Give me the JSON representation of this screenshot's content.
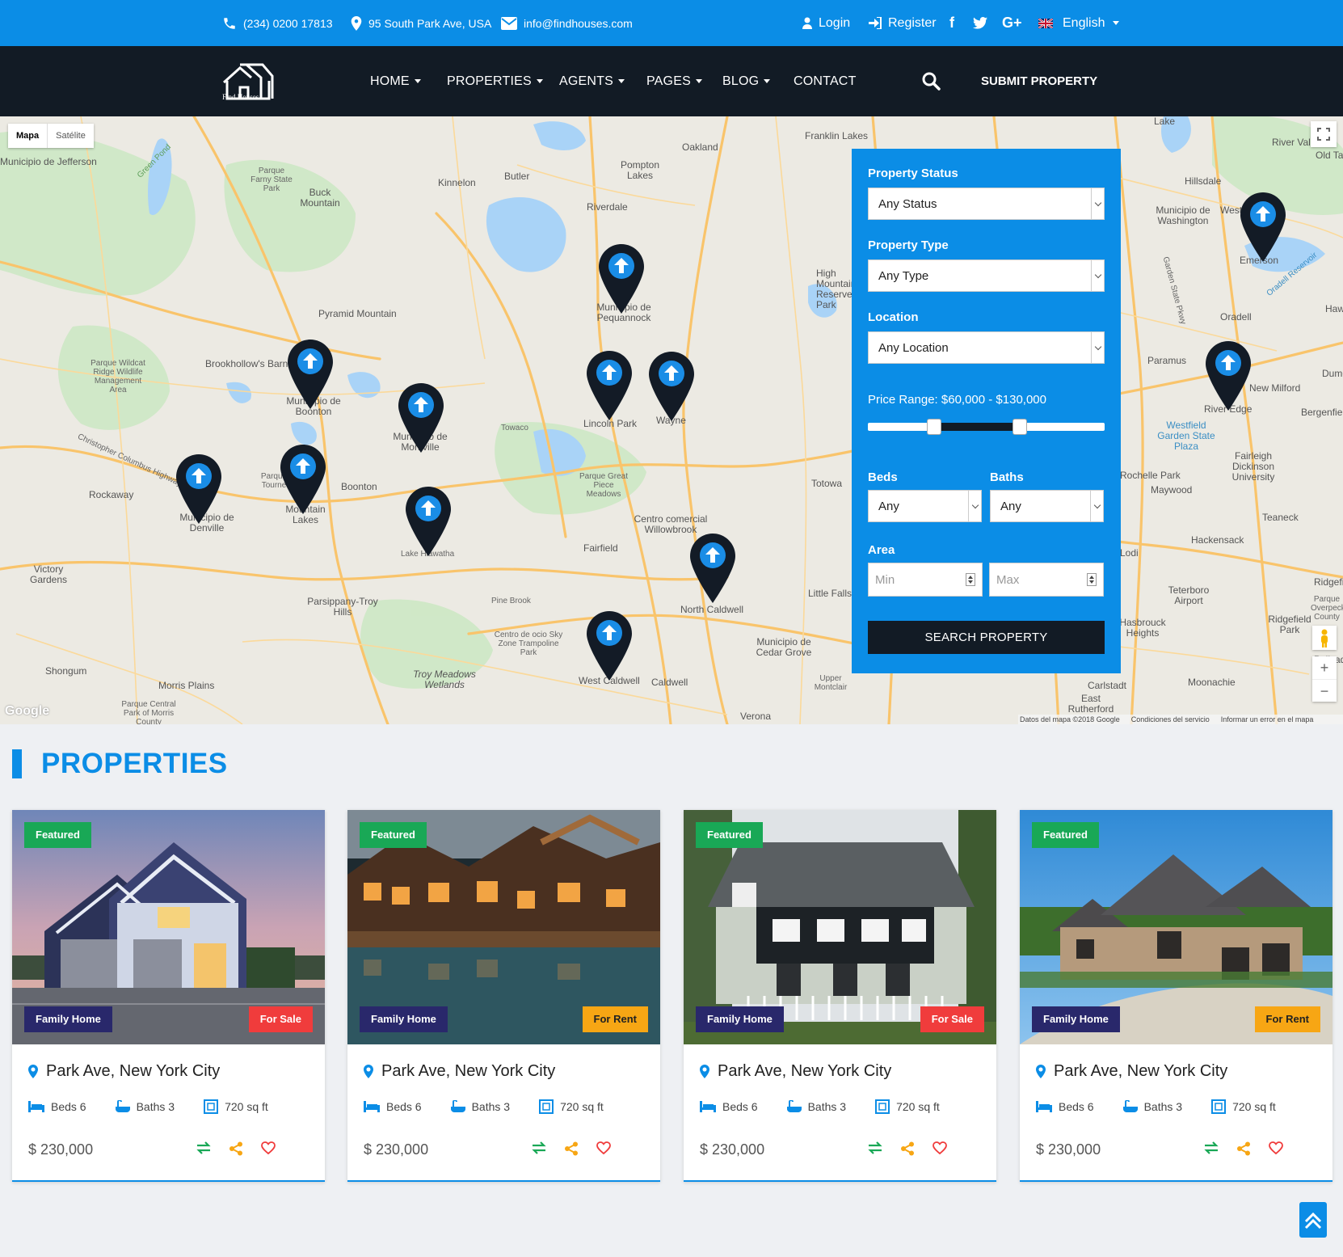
{
  "topbar": {
    "phone": "(234) 0200 17813",
    "address": "95 South Park Ave, USA",
    "email": "info@findhouses.com",
    "login": "Login",
    "register": "Register",
    "social_f": "f",
    "social_g": "G+",
    "language": "English",
    "color": "#0b8de6"
  },
  "nav": {
    "logo_text": "Find Houses",
    "home": "HOME",
    "properties": "PROPERTIES",
    "agents": "AGENTS",
    "pages": "PAGES",
    "blog": "BLOG",
    "contact": "CONTACT",
    "submit": "SUBMIT PROPERTY"
  },
  "map": {
    "type_map": "Mapa",
    "type_sat": "Satélite",
    "google": "Google",
    "attribution": "Datos del mapa ©2018 Google",
    "terms": "Condiciones del servicio",
    "report": "Informar un error en el mapa",
    "labels": [
      "Parque Farny State Park",
      "Buck Mountain",
      "Kinnelon",
      "Butler",
      "Pompton Lakes",
      "Oakland",
      "Franklin Lakes",
      "Riverdale",
      "Pyramid Mountain",
      "Municipio de Pequannock",
      "High Mountain Reserve Park",
      "Brookhollow's Barn",
      "Municipio de Boonton",
      "Municipio de Montville",
      "Lincoln Park",
      "Wayne",
      "Parque Wildcat Ridge Wildlife Management Area",
      "Rockaway",
      "Boonton",
      "Parque Tourne",
      "Mountain Lakes",
      "Municipio de Denville",
      "Parque Great Piece Meadows",
      "Centro comercial Willowbrook",
      "Totowa",
      "Fairfield",
      "Lake Hiawatha",
      "North Caldwell",
      "Little Falls",
      "Parsippany-Troy Hills",
      "Victory Gardens",
      "Centro de ocio Sky Zone Trampoline Park",
      "West Caldwell",
      "Caldwell",
      "Municipio de Cedar Grove",
      "Troy Meadows Wetlands",
      "Shongum",
      "Morris Plains",
      "Parque Central Park of Morris County",
      "Verona",
      "Upper Montclair",
      "Pine Brook",
      "Towaco",
      "Municipio de Washington",
      "Hillsdale",
      "River Vale",
      "Old Tappan",
      "Emerson",
      "Oradell",
      "Paramus",
      "River Edge",
      "New Milford",
      "Bergenfield",
      "Westfield Garden State Plaza",
      "Fairleigh Dickinson University",
      "Rochelle Park",
      "Maywood",
      "Teaneck",
      "Hackensack",
      "Lodi",
      "Teterboro Airport",
      "Ridgefield Park",
      "Moonachie",
      "Carlstadt",
      "East Rutherford",
      "Lake",
      "Green Pond",
      "Oradell Reservoir",
      "Municipio de Jefferson",
      "Christopher Columbus Highway",
      "Garden State Pkwy",
      "Ridgefield",
      "Palisades Park",
      "Dumont",
      "Haworth",
      "Parque Overpeck County",
      "Hasbrouck Heights",
      "West"
    ]
  },
  "search": {
    "status_label": "Property Status",
    "status_value": "Any Status",
    "type_label": "Property Type",
    "type_value": "Any Type",
    "location_label": "Location",
    "location_value": "Any Location",
    "price_label": "Price Range: $60,000 - $130,000",
    "price_min_fraction": 0.28,
    "price_max_fraction": 0.64,
    "beds_label": "Beds",
    "beds_value": "Any",
    "baths_label": "Baths",
    "baths_value": "Any",
    "area_label": "Area",
    "area_min_placeholder": "Min",
    "area_max_placeholder": "Max",
    "button": "SEARCH PROPERTY"
  },
  "section": {
    "title": "PROPERTIES"
  },
  "cards": [
    {
      "featured": "Featured",
      "type": "Family Home",
      "status": "For Sale",
      "address": "Park Ave, New York City",
      "beds": "Beds 6",
      "baths": "Baths 3",
      "area": "720 sq ft",
      "price": "$ 230,000"
    },
    {
      "featured": "Featured",
      "type": "Family Home",
      "status": "For Rent",
      "address": "Park Ave, New York City",
      "beds": "Beds 6",
      "baths": "Baths 3",
      "area": "720 sq ft",
      "price": "$ 230,000"
    },
    {
      "featured": "Featured",
      "type": "Family Home",
      "status": "For Sale",
      "address": "Park Ave, New York City",
      "beds": "Beds 6",
      "baths": "Baths 3",
      "area": "720 sq ft",
      "price": "$ 230,000"
    },
    {
      "featured": "Featured",
      "type": "Family Home",
      "status": "For Rent",
      "address": "Park Ave, New York City",
      "beds": "Beds 6",
      "baths": "Baths 3",
      "area": "720 sq ft",
      "price": "$ 230,000"
    }
  ]
}
